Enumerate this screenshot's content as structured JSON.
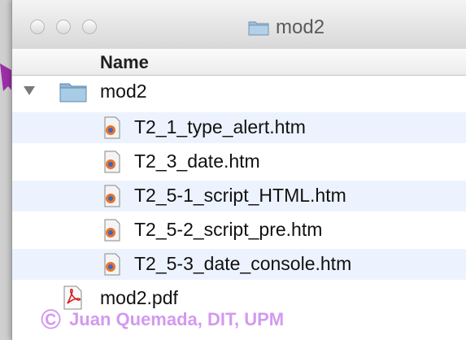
{
  "window": {
    "title": "mod2"
  },
  "header": {
    "name_column": "Name"
  },
  "tree": {
    "folder": {
      "label": "mod2",
      "expanded": true
    },
    "children": [
      {
        "label": "T2_1_type_alert.htm",
        "icon": "html-file-icon"
      },
      {
        "label": "T2_3_date.htm",
        "icon": "html-file-icon"
      },
      {
        "label": "T2_5-1_script_HTML.htm",
        "icon": "html-file-icon"
      },
      {
        "label": "T2_5-2_script_pre.htm",
        "icon": "html-file-icon"
      },
      {
        "label": "T2_5-3_date_console.htm",
        "icon": "html-file-icon"
      }
    ],
    "sibling": {
      "label": "mod2.pdf",
      "icon": "pdf-file-icon"
    }
  },
  "watermark": {
    "symbol": "©",
    "text": "Juan Quemada, DIT, UPM"
  },
  "colors": {
    "row_alt": "#edf3fe",
    "folder_blue": "#8fb6d8",
    "watermark": "#cc88ee",
    "arrow": "#9b2fa8"
  }
}
